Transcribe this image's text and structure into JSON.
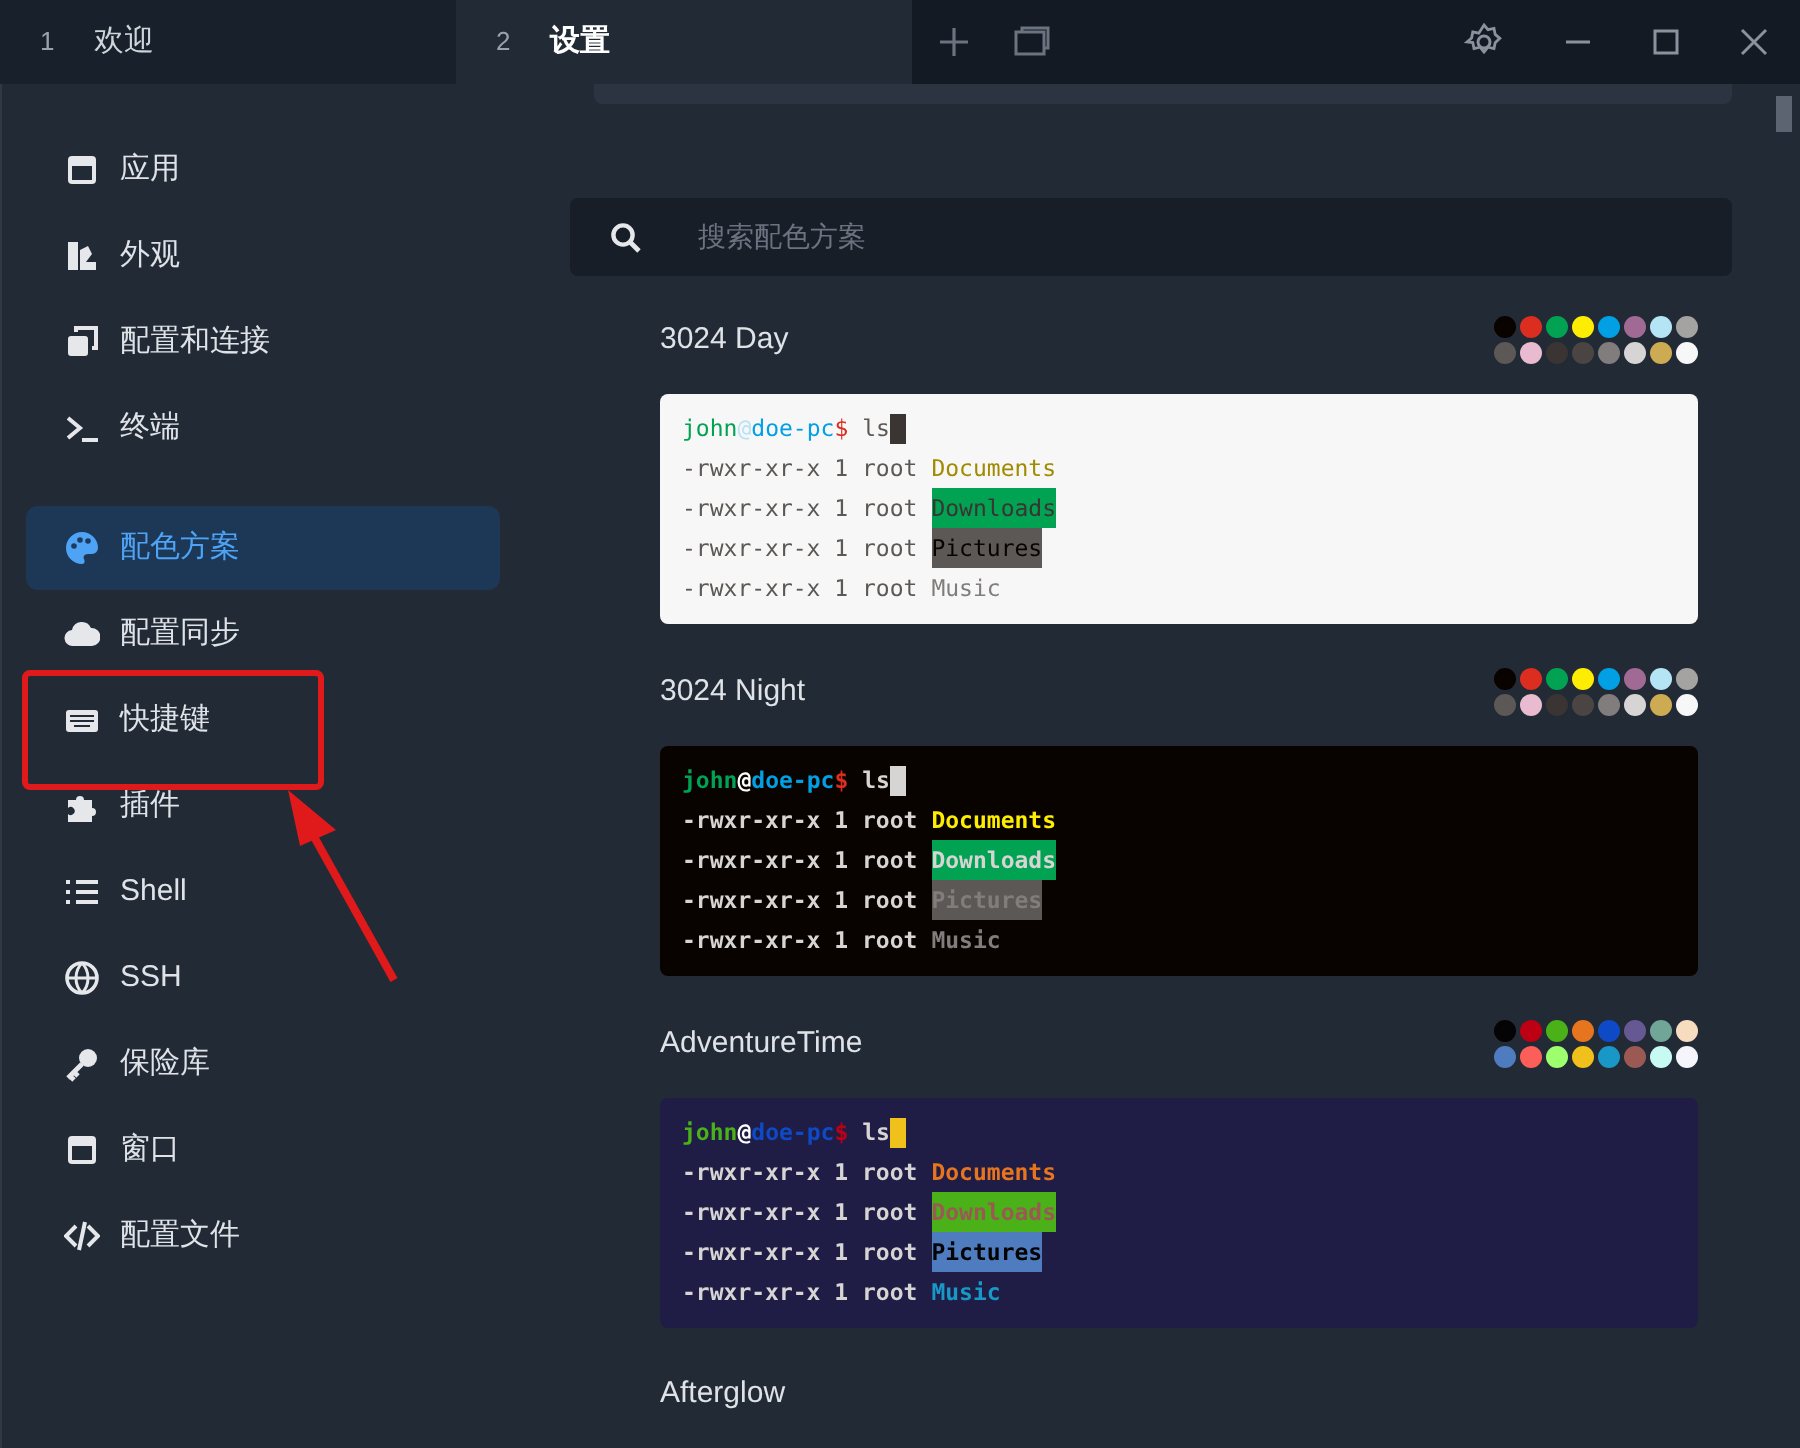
{
  "tabs": [
    {
      "number": "1",
      "label": "欢迎",
      "selected": false
    },
    {
      "number": "2",
      "label": "设置",
      "selected": true
    }
  ],
  "sidebar": {
    "items": [
      {
        "kind": "app",
        "label": "应用",
        "selected": false
      },
      {
        "kind": "appearance",
        "label": "外观",
        "selected": false
      },
      {
        "kind": "profiles",
        "label": "配置和连接",
        "selected": false
      },
      {
        "kind": "terminal",
        "label": "终端",
        "selected": false
      },
      {
        "kind": "colors",
        "label": "配色方案",
        "selected": true
      },
      {
        "kind": "sync",
        "label": "配置同步",
        "selected": false
      },
      {
        "kind": "hotkeys",
        "label": "快捷键",
        "selected": false
      },
      {
        "kind": "plugins",
        "label": "插件",
        "selected": false
      },
      {
        "kind": "shell",
        "label": "Shell",
        "selected": false
      },
      {
        "kind": "ssh",
        "label": "SSH",
        "selected": false
      },
      {
        "kind": "vault",
        "label": "保险库",
        "selected": false
      },
      {
        "kind": "window",
        "label": "窗口",
        "selected": false
      },
      {
        "kind": "config",
        "label": "配置文件",
        "selected": false
      }
    ]
  },
  "search": {
    "placeholder": "搜索配色方案"
  },
  "schemes": [
    {
      "name": "3024 Day",
      "terminal": {
        "color": "#f7f7f7"
      },
      "palette": [
        {
          "color": "#090300"
        },
        {
          "color": "#db2d20"
        },
        {
          "color": "#01a252"
        },
        {
          "color": "#fded02"
        },
        {
          "color": "#01a0e4"
        },
        {
          "color": "#a16a94"
        },
        {
          "color": "#b5e4f4"
        },
        {
          "color": "#a5a2a2"
        },
        {
          "color": "#5c5855"
        },
        {
          "color": "#e8bbd0"
        },
        {
          "color": "#3a3432"
        },
        {
          "color": "#4a4543"
        },
        {
          "color": "#807d7c"
        },
        {
          "color": "#d6d5d4"
        },
        {
          "color": "#cdab53"
        },
        {
          "color": "#f7f7f7"
        }
      ],
      "prompt": {
        "user": "john",
        "at": "@",
        "host": "doe-pc",
        "dollar": "$",
        "command": "ls"
      },
      "lines": [
        {
          "meta": "-rwxr-xr-x 1 root",
          "file": "Documents"
        },
        {
          "meta": "-rwxr-xr-x 1 root",
          "file": "Downloads"
        },
        {
          "meta": "-rwxr-xr-x 1 root",
          "file": "Pictures"
        },
        {
          "meta": "-rwxr-xr-x 1 root",
          "file": "Music"
        }
      ]
    },
    {
      "name": "3024 Night",
      "terminal": {
        "color": "#090300"
      },
      "palette": [
        {
          "color": "#090300"
        },
        {
          "color": "#db2d20"
        },
        {
          "color": "#01a252"
        },
        {
          "color": "#fded02"
        },
        {
          "color": "#01a0e4"
        },
        {
          "color": "#a16a94"
        },
        {
          "color": "#b5e4f4"
        },
        {
          "color": "#a5a2a2"
        },
        {
          "color": "#5c5855"
        },
        {
          "color": "#e8bbd0"
        },
        {
          "color": "#3a3432"
        },
        {
          "color": "#4a4543"
        },
        {
          "color": "#807d7c"
        },
        {
          "color": "#d6d5d4"
        },
        {
          "color": "#cdab53"
        },
        {
          "color": "#f7f7f7"
        }
      ],
      "prompt": {
        "user": "john",
        "at": "@",
        "host": "doe-pc",
        "dollar": "$",
        "command": "ls"
      },
      "lines": [
        {
          "meta": "-rwxr-xr-x 1 root",
          "file": "Documents"
        },
        {
          "meta": "-rwxr-xr-x 1 root",
          "file": "Downloads"
        },
        {
          "meta": "-rwxr-xr-x 1 root",
          "file": "Pictures"
        },
        {
          "meta": "-rwxr-xr-x 1 root",
          "file": "Music"
        }
      ]
    },
    {
      "name": "AdventureTime",
      "terminal": {
        "color": "#1f1d45"
      },
      "palette": [
        {
          "color": "#050404"
        },
        {
          "color": "#bd0013"
        },
        {
          "color": "#4ab118"
        },
        {
          "color": "#e7741e"
        },
        {
          "color": "#0f4ac6"
        },
        {
          "color": "#665993"
        },
        {
          "color": "#70a598"
        },
        {
          "color": "#f8dcc0"
        },
        {
          "color": "#4e7cbf"
        },
        {
          "color": "#fc5f5a"
        },
        {
          "color": "#9eff6e"
        },
        {
          "color": "#efc11a"
        },
        {
          "color": "#1997c6"
        },
        {
          "color": "#9b5953"
        },
        {
          "color": "#c8faf4"
        },
        {
          "color": "#f6f5fb"
        }
      ],
      "prompt": {
        "user": "john",
        "at": "@",
        "host": "doe-pc",
        "dollar": "$",
        "command": "ls"
      },
      "lines": [
        {
          "meta": "-rwxr-xr-x 1 root",
          "file": "Documents"
        },
        {
          "meta": "-rwxr-xr-x 1 root",
          "file": "Downloads"
        },
        {
          "meta": "-rwxr-xr-x 1 root",
          "file": "Pictures"
        },
        {
          "meta": "-rwxr-xr-x 1 root",
          "file": "Music"
        }
      ]
    },
    {
      "name": "Afterglow"
    }
  ]
}
